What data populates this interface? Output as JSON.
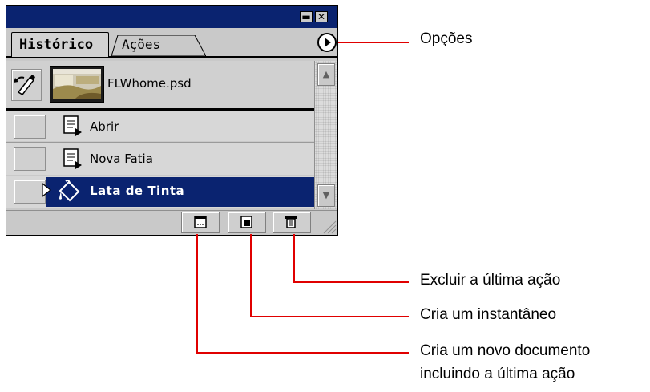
{
  "panel": {
    "tabs": [
      {
        "label": "Histórico",
        "active": true
      },
      {
        "label": "Ações",
        "active": false
      }
    ],
    "snapshot": {
      "filename": "FLWhome.psd"
    },
    "history_steps": [
      {
        "label": "Abrir",
        "icon": "document-icon",
        "selected": false
      },
      {
        "label": "Nova Fatia",
        "icon": "document-icon",
        "selected": false
      },
      {
        "label": "Lata de Tinta",
        "icon": "paint-bucket-icon",
        "selected": true
      }
    ],
    "colors": {
      "titlebar": "#0a2370",
      "selection": "#0a2370",
      "callout_line": "#e00000"
    }
  },
  "callouts": {
    "options": "Opções",
    "delete_step": "Excluir a última ação",
    "create_snapshot": "Cria um instantâneo",
    "new_document_line1": "Cria um novo documento",
    "new_document_line2": "incluindo a última ação"
  }
}
